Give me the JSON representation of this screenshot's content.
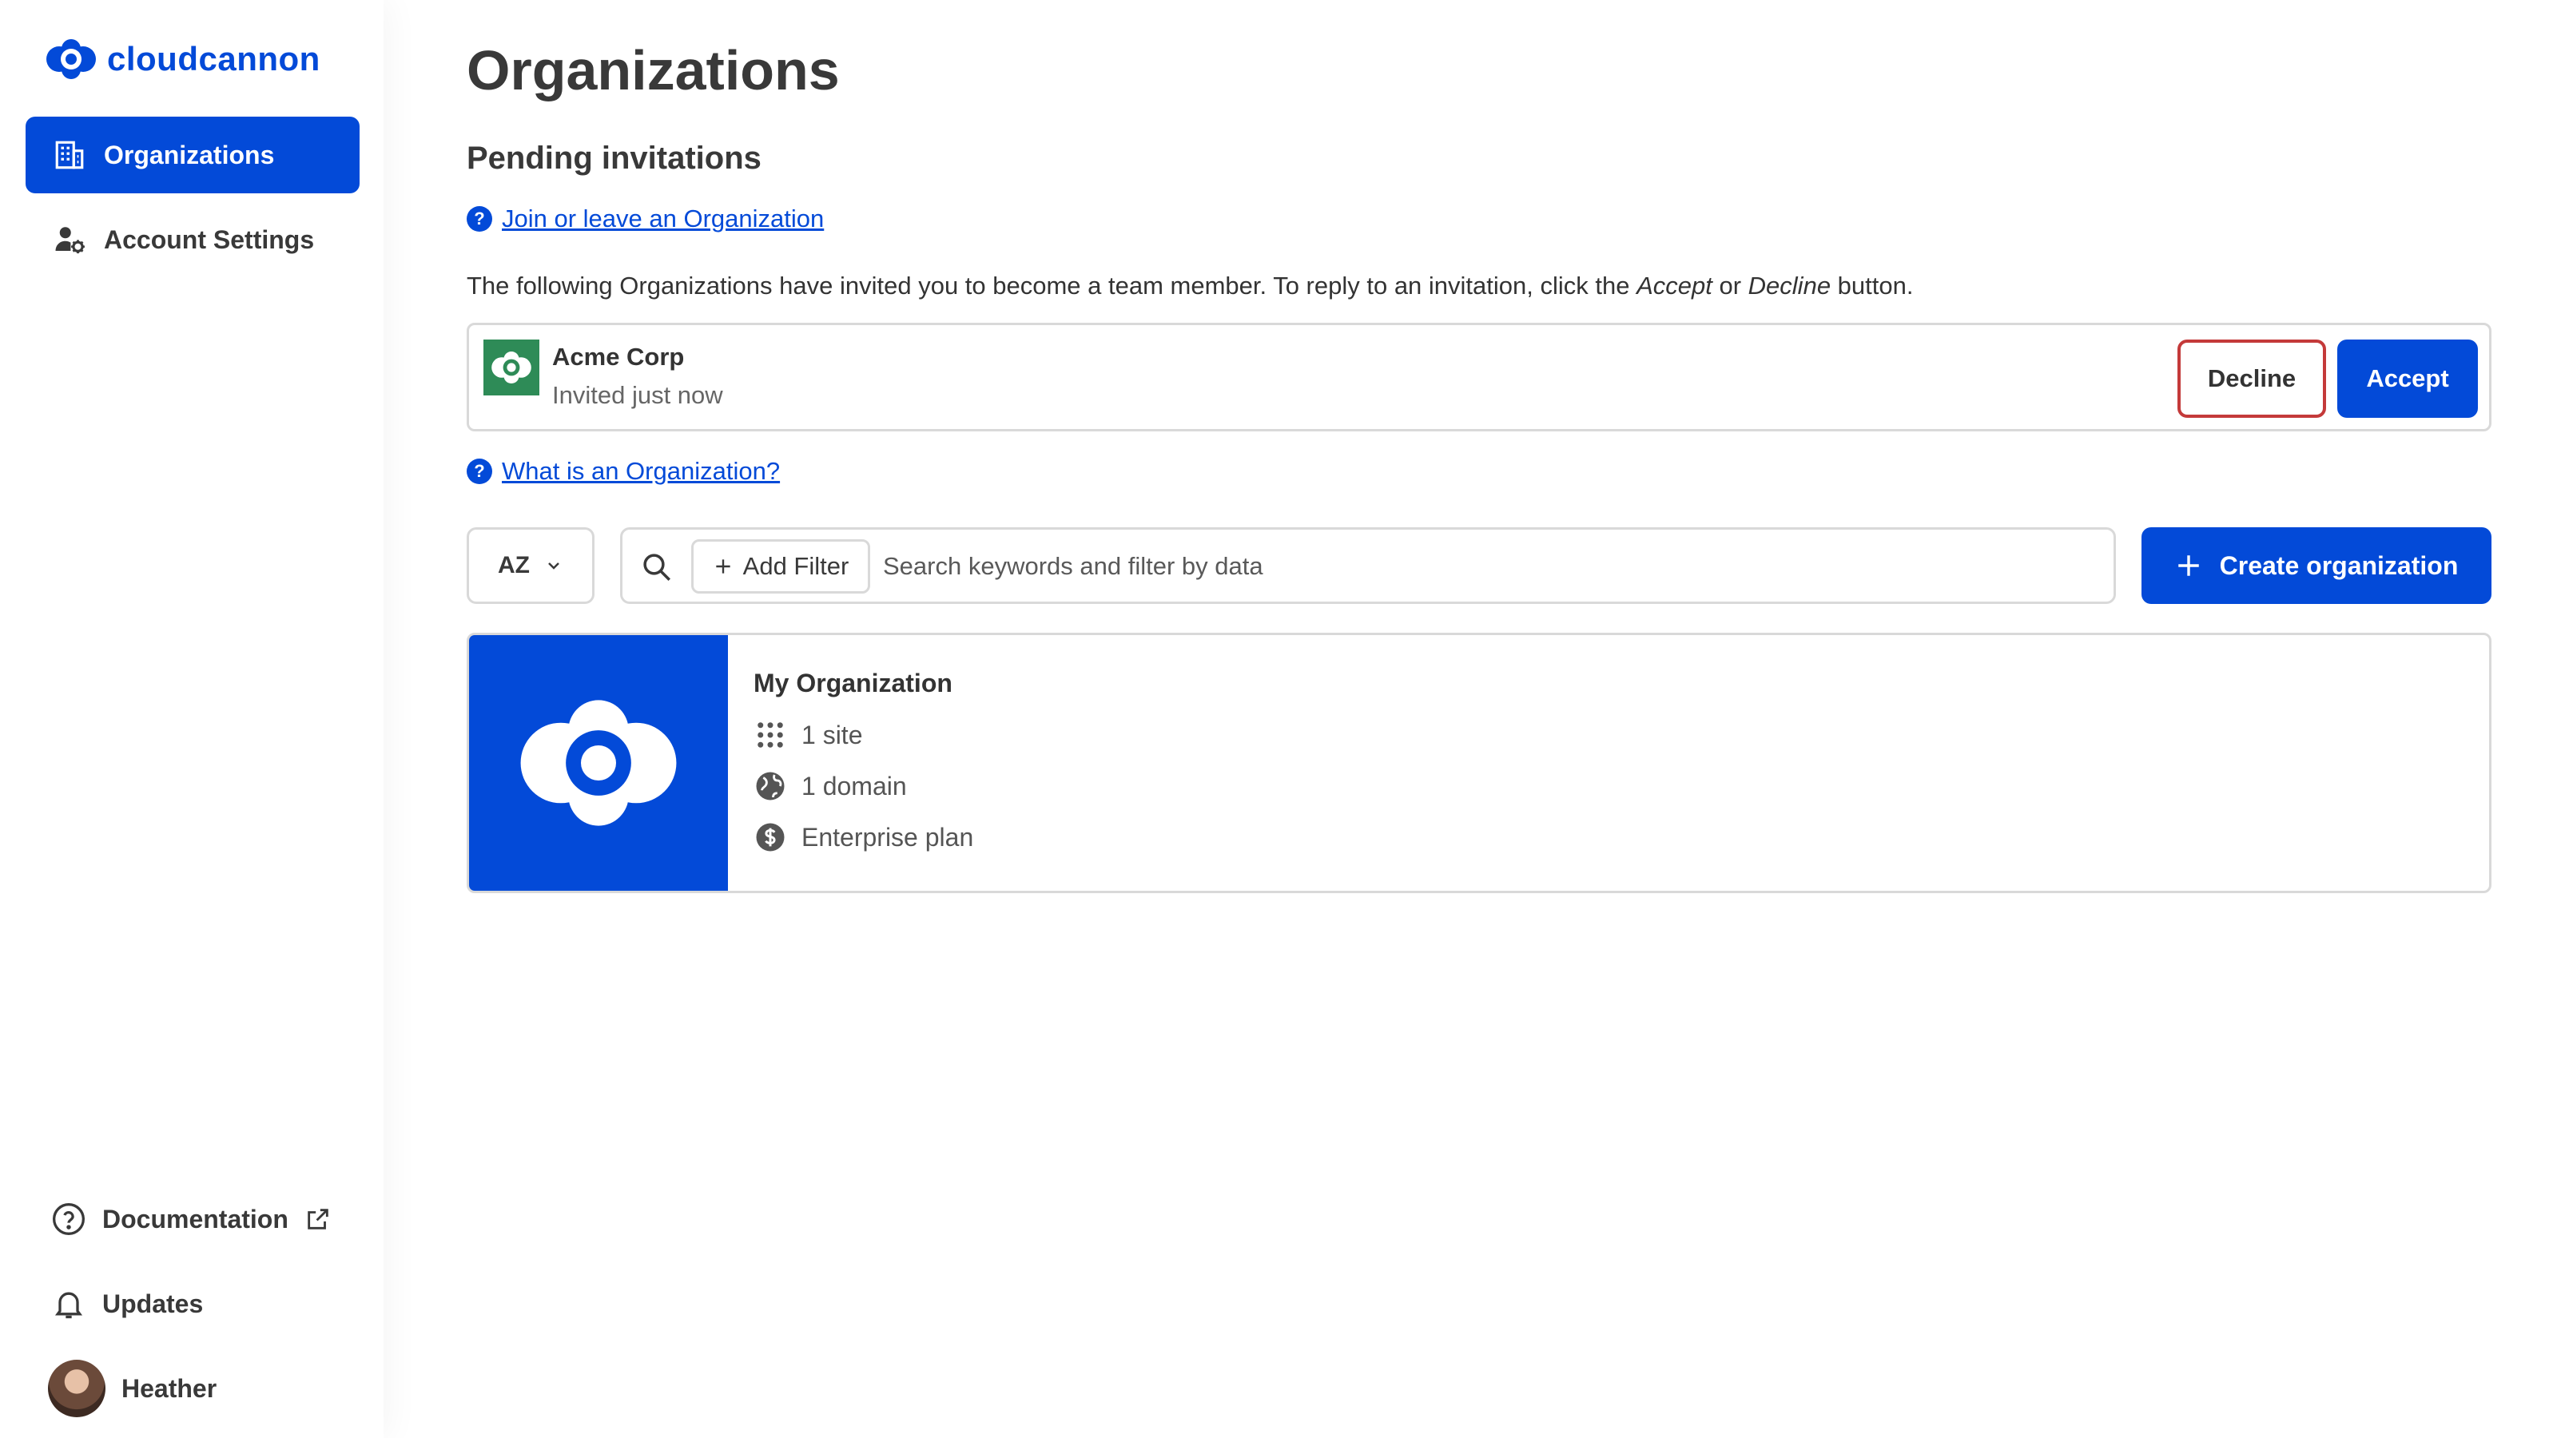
{
  "brand": {
    "name": "cloudcannon",
    "color": "#034ad8"
  },
  "sidebar": {
    "items": [
      {
        "label": "Organizations",
        "icon": "building-icon",
        "active": true
      },
      {
        "label": "Account Settings",
        "icon": "user-gear-icon",
        "active": false
      }
    ],
    "bottom": [
      {
        "label": "Documentation",
        "icon": "help-circle-icon",
        "external_icon": "external-link-icon"
      },
      {
        "label": "Updates",
        "icon": "bell-icon"
      },
      {
        "label": "Heather",
        "icon": "avatar"
      }
    ]
  },
  "main": {
    "title": "Organizations",
    "pending": {
      "title": "Pending invitations",
      "help_link": "Join or leave an Organization",
      "intro_before": "The following Organizations have invited you to become a team member. To reply to an invitation, click the ",
      "intro_accept": "Accept",
      "intro_or": " or ",
      "intro_decline": "Decline",
      "intro_after": " button.",
      "invitation": {
        "org_name": "Acme Corp",
        "status": "Invited just now",
        "logo_color": "#2e8b57",
        "decline_label": "Decline",
        "accept_label": "Accept"
      }
    },
    "what_is_link": "What is an Organization?",
    "toolbar": {
      "sort_label": "AZ",
      "add_filter_label": "Add Filter",
      "search_placeholder": "Search keywords and filter by data",
      "search_value": "",
      "create_label": "Create organization"
    },
    "organizations": [
      {
        "name": "My Organization",
        "sites": "1 site",
        "domains": "1 domain",
        "plan": "Enterprise plan"
      }
    ]
  }
}
